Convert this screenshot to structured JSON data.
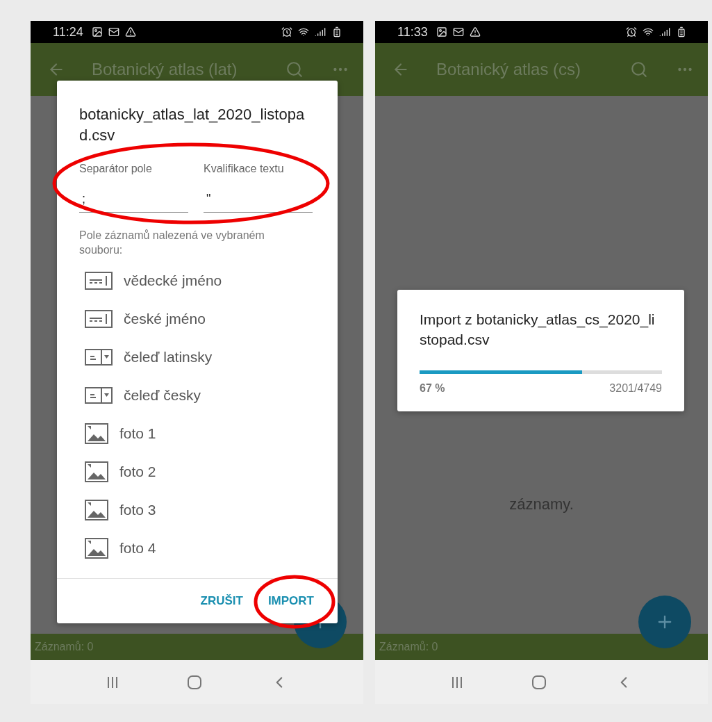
{
  "screens": [
    {
      "status_bar": {
        "time": "11:24"
      },
      "app_bar": {
        "title": "Botanický atlas (lat)"
      },
      "footer": "Záznamů: 0",
      "dialog": {
        "kind": "import_setup",
        "title": "botanicky_atlas_lat_2020_listopad.csv",
        "fields": [
          {
            "label": "Separátor pole",
            "value": ";"
          },
          {
            "label": "Kvalifikace textu",
            "value": "\""
          }
        ],
        "caption": "Pole záznamů nalezená ve vybraném souboru:",
        "items": [
          {
            "kind": "text",
            "label": "vědecké jméno"
          },
          {
            "kind": "text",
            "label": "české jméno"
          },
          {
            "kind": "choice",
            "label": "čeleď latinsky"
          },
          {
            "kind": "choice",
            "label": "čeleď česky"
          },
          {
            "kind": "image",
            "label": "foto 1"
          },
          {
            "kind": "image",
            "label": "foto 2"
          },
          {
            "kind": "image",
            "label": "foto 3"
          },
          {
            "kind": "image",
            "label": "foto 4"
          }
        ],
        "buttons": [
          "ZRUŠIT",
          "IMPORT"
        ]
      }
    },
    {
      "status_bar": {
        "time": "11:33"
      },
      "app_bar": {
        "title": "Botanický atlas (cs)"
      },
      "footer": "Záznamů: 0",
      "empty_text": "záznamy.",
      "dialog": {
        "kind": "progress",
        "title": "Import z botanicky_atlas_cs_2020_listopad.csv",
        "level": 0.67,
        "percent": "67 %",
        "count": "3201/4749"
      }
    }
  ]
}
